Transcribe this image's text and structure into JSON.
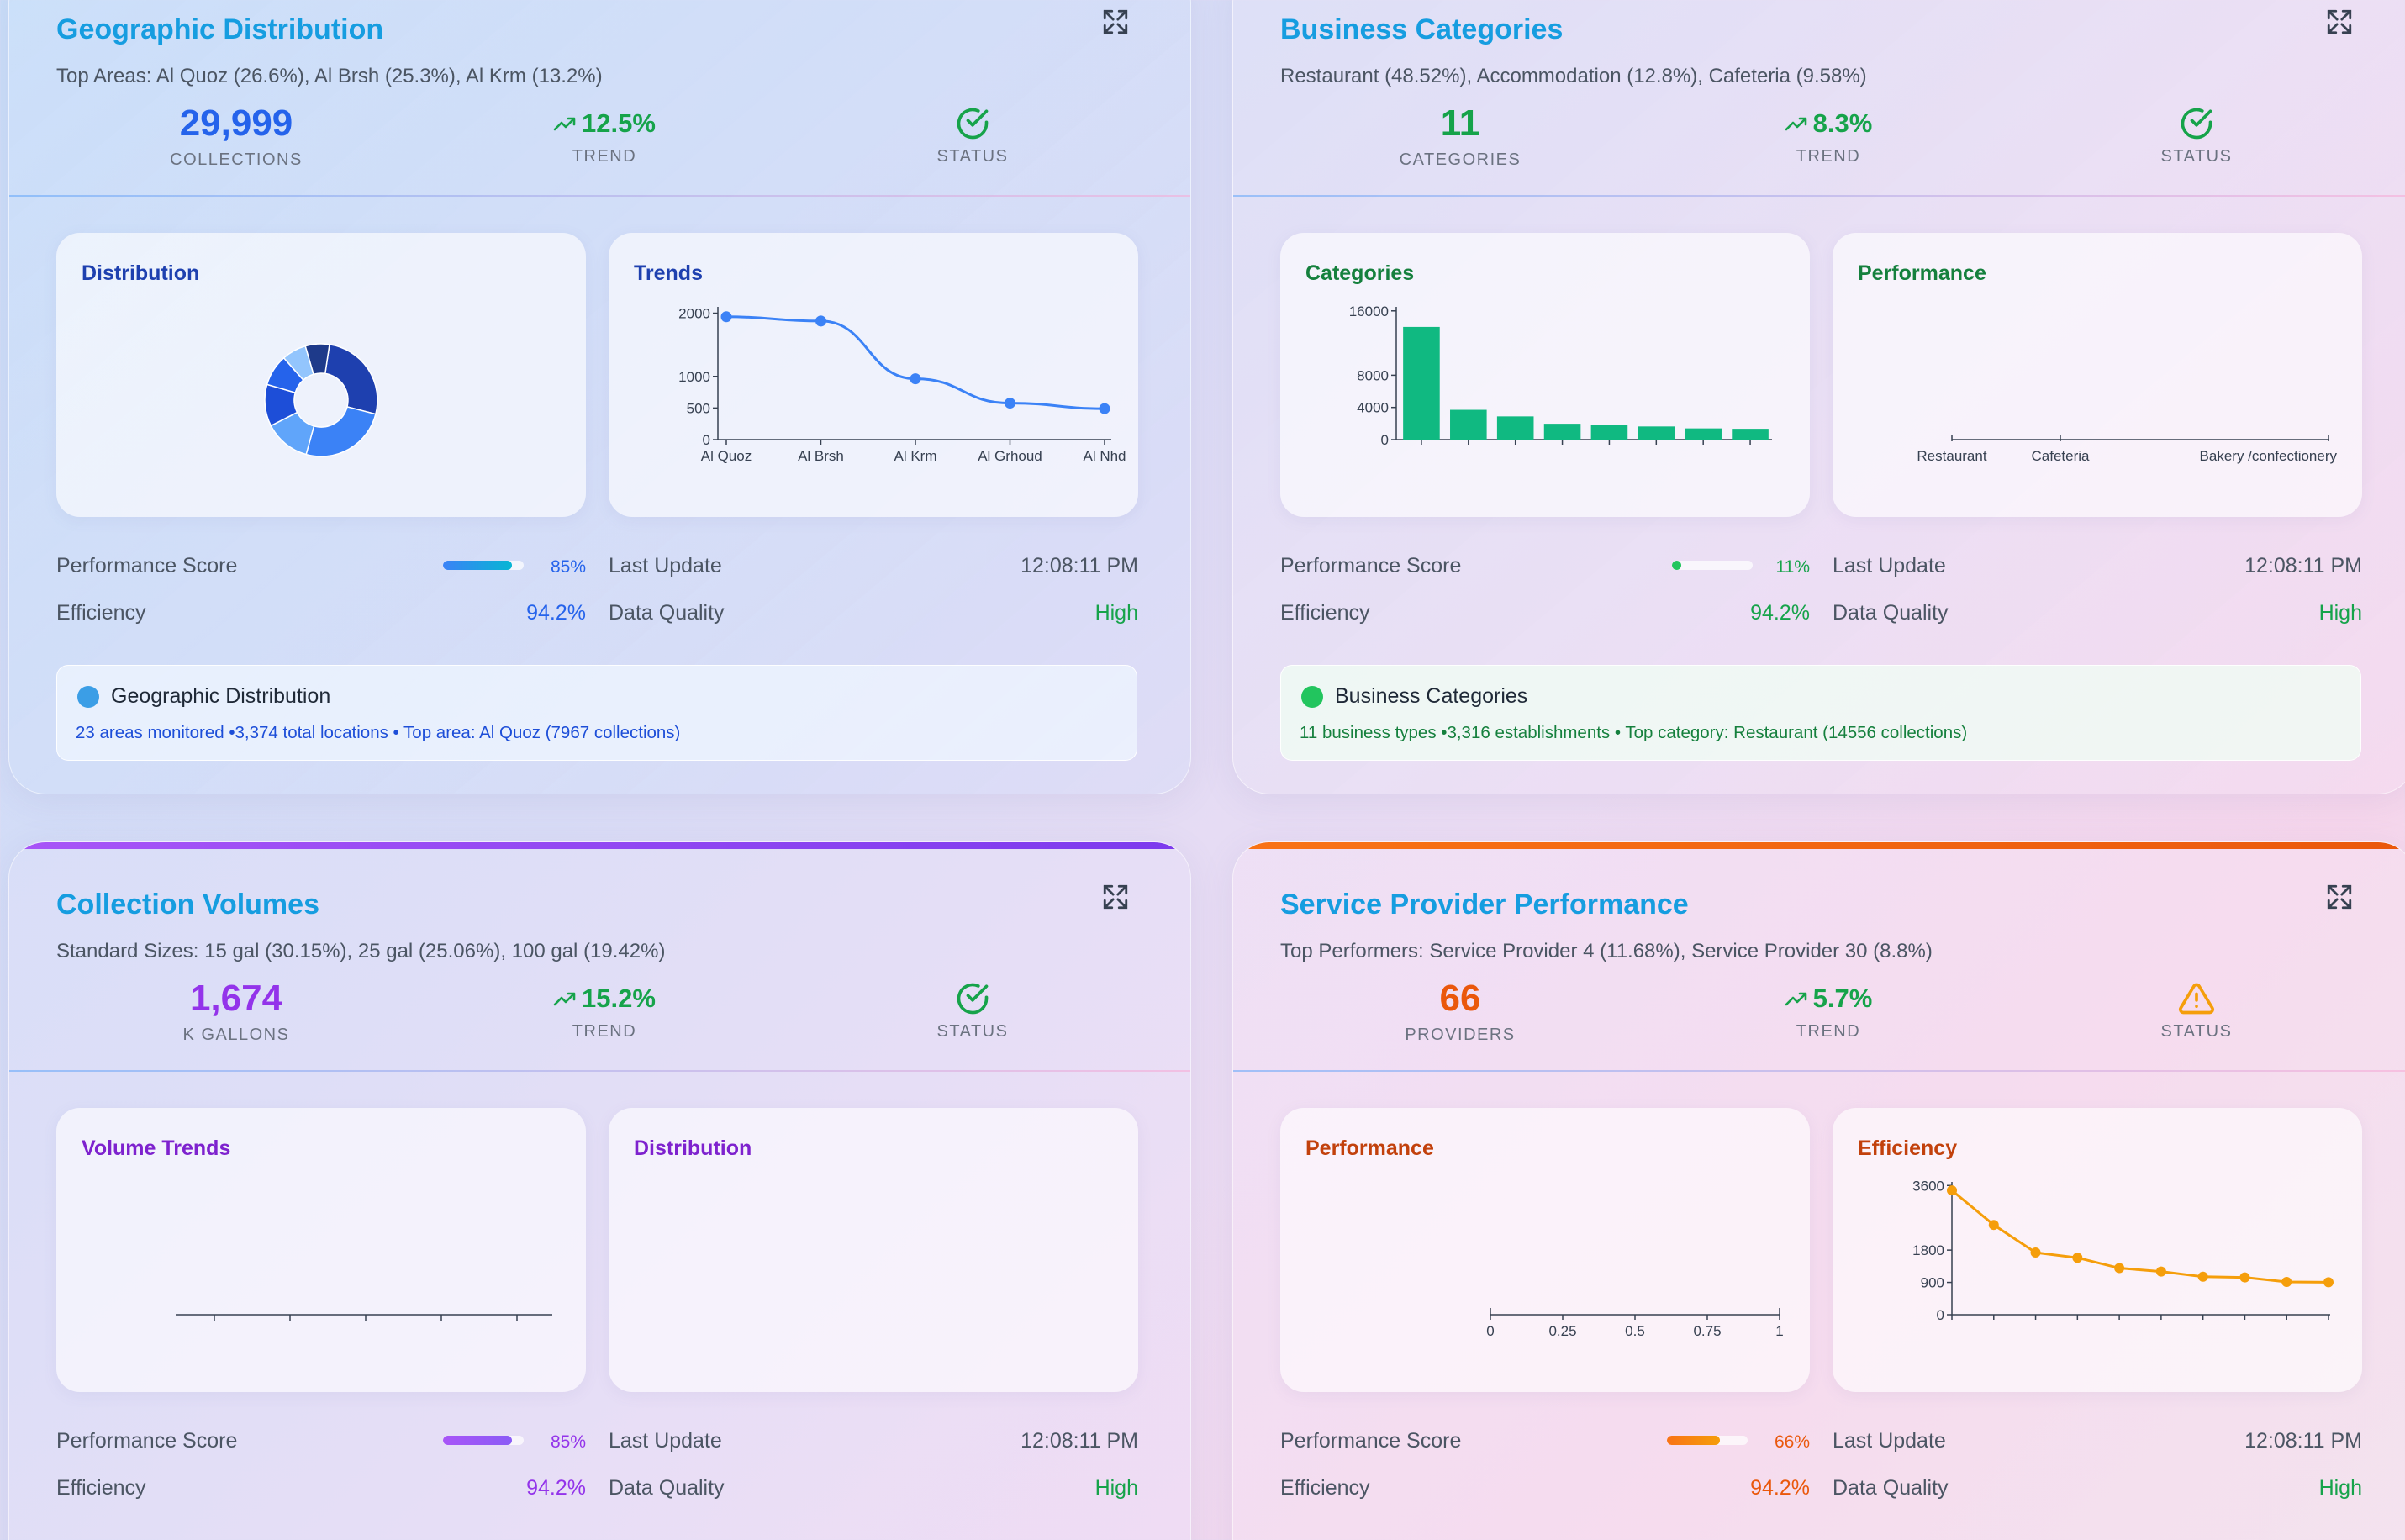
{
  "cards": [
    {
      "title": "Geographic Distribution",
      "subtitle": "Top Areas: Al Quoz (26.6%), Al Brsh (25.3%), Al Krm (13.2%)",
      "kpi_value": "29,999",
      "kpi_label": "COLLECTIONS",
      "trend": "12.5%",
      "trend_label": "TREND",
      "status_label": "STATUS",
      "status": "check",
      "panel1_title": "Distribution",
      "panel2_title": "Trends",
      "performance_label": "Performance Score",
      "performance_pct": "85%",
      "performance_value": 0.85,
      "efficiency_label": "Efficiency",
      "efficiency_value": "94.2%",
      "last_update_label": "Last Update",
      "last_update_value": "12:08:11 PM",
      "quality_label": "Data Quality",
      "quality_value": "High",
      "info_title": "Geographic Distribution",
      "info_desc": "23 areas monitored •3,374 total locations • Top area: Al Quoz (7967 collections)",
      "accent": "#2563eb"
    },
    {
      "title": "Business Categories",
      "subtitle": "Restaurant (48.52%), Accommodation (12.8%), Cafeteria (9.58%)",
      "kpi_value": "11",
      "kpi_label": "CATEGORIES",
      "trend": "8.3%",
      "trend_label": "TREND",
      "status_label": "STATUS",
      "status": "check",
      "panel1_title": "Categories",
      "panel2_title": "Performance",
      "performance_label": "Performance Score",
      "performance_pct": "11%",
      "performance_value": 0.11,
      "efficiency_label": "Efficiency",
      "efficiency_value": "94.2%",
      "last_update_label": "Last Update",
      "last_update_value": "12:08:11 PM",
      "quality_label": "Data Quality",
      "quality_value": "High",
      "info_title": "Business Categories",
      "info_desc": "11 business types •3,316 establishments • Top category: Restaurant (14556 collections)",
      "accent": "#16a34a"
    },
    {
      "title": "Collection Volumes",
      "subtitle": "Standard Sizes: 15 gal (30.15%), 25 gal (25.06%), 100 gal (19.42%)",
      "kpi_value": "1,674",
      "kpi_label": "K GALLONS",
      "trend": "15.2%",
      "trend_label": "TREND",
      "status_label": "STATUS",
      "status": "check",
      "panel1_title": "Volume Trends",
      "panel2_title": "Distribution",
      "performance_label": "Performance Score",
      "performance_pct": "85%",
      "performance_value": 0.85,
      "efficiency_label": "Efficiency",
      "efficiency_value": "94.2%",
      "last_update_label": "Last Update",
      "last_update_value": "12:08:11 PM",
      "quality_label": "Data Quality",
      "quality_value": "High",
      "accent": "#9333ea"
    },
    {
      "title": "Service Provider Performance",
      "subtitle": "Top Performers: Service Provider 4 (11.68%), Service Provider 30 (8.8%)",
      "kpi_value": "66",
      "kpi_label": "PROVIDERS",
      "trend": "5.7%",
      "trend_label": "TREND",
      "status_label": "STATUS",
      "status": "warning",
      "panel1_title": "Performance",
      "panel2_title": "Efficiency",
      "performance_label": "Performance Score",
      "performance_pct": "66%",
      "performance_value": 0.66,
      "efficiency_label": "Efficiency",
      "efficiency_value": "94.2%",
      "last_update_label": "Last Update",
      "last_update_value": "12:08:11 PM",
      "quality_label": "Data Quality",
      "quality_value": "High",
      "accent": "#ea580c"
    }
  ],
  "colors": {
    "blue": "#2563eb",
    "green": "#16a34a",
    "purple": "#9333ea",
    "orange": "#ea580c",
    "title_cyan": "#169de0",
    "high": "#16a34a"
  },
  "icons": {
    "expand": "expand-icon",
    "trend": "trend-up-icon",
    "status_ok": "check-circle-icon",
    "status_warn": "warning-triangle-icon"
  },
  "chart_data": [
    {
      "type": "pie",
      "panel": "Geographic Distribution / Distribution",
      "variant": "donut",
      "values": [
        26.6,
        25.3,
        13.2,
        12,
        9,
        7,
        6.9
      ],
      "colors": [
        "#1e40af",
        "#3b82f6",
        "#60a5fa",
        "#1d4ed8",
        "#2563eb",
        "#93c5fd",
        "#1e3a8a"
      ]
    },
    {
      "type": "line",
      "panel": "Geographic Distribution / Trends",
      "categories": [
        "Al Quoz",
        "Al Brsh",
        "Al Krm",
        "Al Grhoud",
        "Al Nhd"
      ],
      "values": [
        2020,
        1950,
        1000,
        600,
        510
      ],
      "yticks": [
        0,
        500,
        1000,
        2000
      ],
      "ylim": [
        0,
        2100
      ],
      "color": "#3b82f6"
    },
    {
      "type": "bar",
      "panel": "Business Categories / Categories",
      "values": [
        14556,
        3850,
        3000,
        2050,
        1900,
        1700,
        1450,
        1400
      ],
      "yticks": [
        0,
        4000,
        8000,
        16000
      ],
      "ylim": [
        0,
        16500
      ],
      "color": "#10b981"
    },
    {
      "type": "bar",
      "panel": "Business Categories / Performance",
      "categories": [
        "Restaurant",
        "Cafeteria",
        "Bakery /confectionery"
      ],
      "values": []
    },
    {
      "type": "line",
      "panel": "Collection Volumes / Volume Trends",
      "values": []
    },
    {
      "type": "pie",
      "panel": "Collection Volumes / Distribution",
      "values": []
    },
    {
      "type": "bar",
      "panel": "Service Provider Performance / Performance",
      "xticks": [
        "0",
        "0.25",
        "0.5",
        "0.75",
        "1"
      ],
      "values": []
    },
    {
      "type": "line",
      "panel": "Service Provider Performance / Efficiency",
      "values": [
        3600,
        2600,
        1800,
        1650,
        1350,
        1250,
        1100,
        1080,
        950,
        940
      ],
      "yticks": [
        0,
        900,
        1800,
        3600
      ],
      "ylim": [
        0,
        3700
      ],
      "color": "#f59e0b"
    }
  ]
}
